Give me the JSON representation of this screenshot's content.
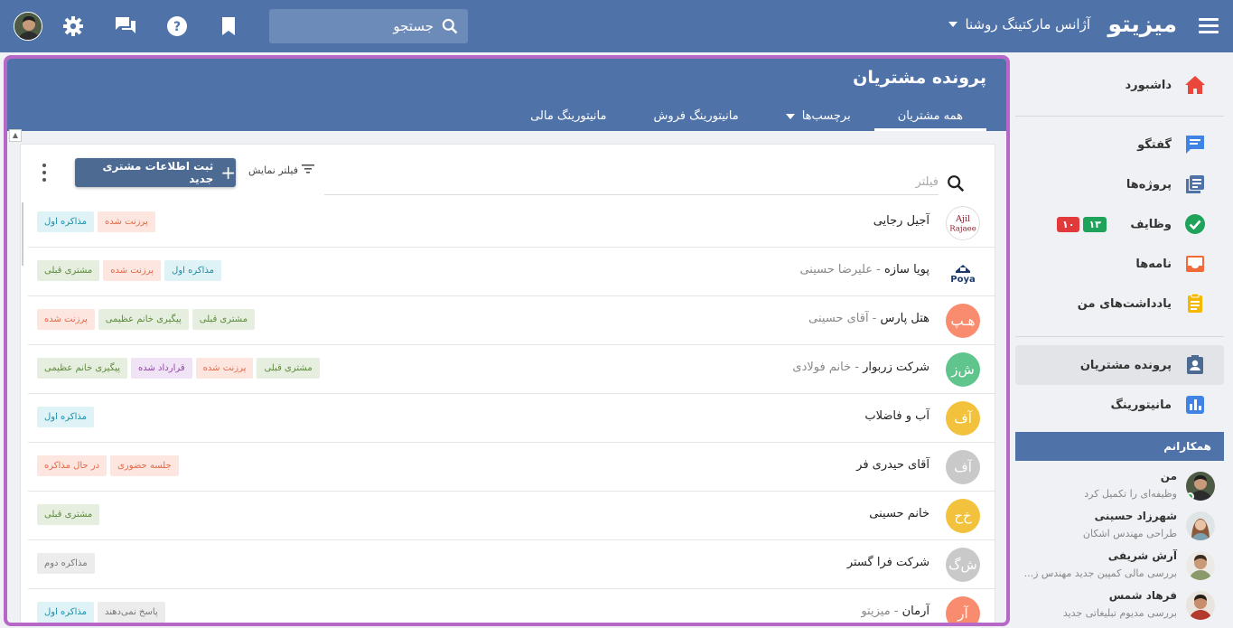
{
  "topbar": {
    "logo": "میزیتو",
    "agency": "آژانس مارکتینگ روشنا",
    "search_placeholder": "جستجو"
  },
  "sidebar": {
    "items": [
      {
        "label": "داشبورد",
        "icon": "home-icon"
      },
      {
        "label": "گفتگو",
        "icon": "chat-icon"
      },
      {
        "label": "پروژه‌ها",
        "icon": "projects-icon"
      },
      {
        "label": "وظایف",
        "icon": "check-circle-icon"
      },
      {
        "label": "نامه‌ها",
        "icon": "inbox-icon"
      },
      {
        "label": "یادداشت‌های من",
        "icon": "notes-icon"
      },
      {
        "label": "پرونده مشتریان",
        "icon": "contact-card-icon"
      },
      {
        "label": "مانیتورینگ",
        "icon": "bar-chart-icon"
      }
    ],
    "task_badges": {
      "green": "۱۳",
      "red": "۱۰"
    },
    "colleagues_title": "همکارانم",
    "colleagues": [
      {
        "name": "من",
        "status": "وظیفه‌ای را تکمیل کرد"
      },
      {
        "name": "شهرزاد حسینی",
        "status": "طراحی مهندس اشکان"
      },
      {
        "name": "آرش شریفی",
        "status": "بررسی مالی کمپین جدید مهندس ز..."
      },
      {
        "name": "فرهاد شمس",
        "status": "بررسی مدیوم تبلیغاتی جدید"
      }
    ]
  },
  "main": {
    "title": "پرونده مشتریان",
    "tabs": [
      "همه مشتریان",
      "برچسب‌ها",
      "مانیتورینگ فروش",
      "مانیتورینگ مالی"
    ],
    "filter_placeholder": "فیلتر",
    "filter_display_label": "فیلتر نمایش",
    "new_button_label": "ثبت اطلاعات مشتری جدید"
  },
  "customers": [
    {
      "name": "آجیل رجایی",
      "contact": "",
      "avatar": "Ajil Rajaee",
      "avatar_color": "#ffffff",
      "tags": [
        {
          "label": "مذاکره اول",
          "color": "blue"
        },
        {
          "label": "پرزنت شده",
          "color": "red"
        }
      ]
    },
    {
      "name": "پویا سازه",
      "contact": "علیرضا حسینی",
      "avatar": "Poya",
      "avatar_color": "#ffffff",
      "tags": [
        {
          "label": "مشتری قبلی",
          "color": "green"
        },
        {
          "label": "پرزنت شده",
          "color": "red"
        },
        {
          "label": "مذاکره اول",
          "color": "blue"
        }
      ]
    },
    {
      "name": "هتل پارس",
      "contact": "آقای حسینی",
      "avatar": "هـپ",
      "avatar_color": "#f98c6e",
      "tags": [
        {
          "label": "پرزنت شده",
          "color": "red"
        },
        {
          "label": "پیگیری خانم عظیمی",
          "color": "green"
        },
        {
          "label": "مشتری قبلی",
          "color": "green"
        }
      ]
    },
    {
      "name": "شرکت زربوار",
      "contact": "خانم فولادی",
      "avatar": "ش‌ز",
      "avatar_color": "#5fc58d",
      "tags": [
        {
          "label": "پیگیری خانم عظیمی",
          "color": "green"
        },
        {
          "label": "قرارداد شده",
          "color": "purple"
        },
        {
          "label": "پرزنت شده",
          "color": "red"
        },
        {
          "label": "مشتری قبلی",
          "color": "green"
        }
      ]
    },
    {
      "name": "آب و فاضلاب",
      "contact": "",
      "avatar": "آف",
      "avatar_color": "#f3c23c",
      "tags": [
        {
          "label": "مذاکره اول",
          "color": "blue"
        }
      ]
    },
    {
      "name": "آقای حیدری فر",
      "contact": "",
      "avatar": "آف",
      "avatar_color": "#c9c9c9",
      "tags": [
        {
          "label": "در حال مذاکره",
          "color": "red"
        },
        {
          "label": "جلسه حضوری",
          "color": "red"
        }
      ]
    },
    {
      "name": "خانم حسینی",
      "contact": "",
      "avatar": "خ‌ح",
      "avatar_color": "#f3c23c",
      "tags": [
        {
          "label": "مشتری قبلی",
          "color": "green"
        }
      ]
    },
    {
      "name": "شرکت فرا گستر",
      "contact": "",
      "avatar": "ش‌گ",
      "avatar_color": "#c9c9c9",
      "tags": [
        {
          "label": "مذاکره دوم",
          "color": "gray"
        }
      ]
    },
    {
      "name": "آرمان",
      "contact": "میزیتو",
      "avatar": "آر",
      "avatar_color": "#f98c6e",
      "tags": [
        {
          "label": "مذاکره اول",
          "color": "blue"
        },
        {
          "label": "پاسخ نمی‌دهند",
          "color": "gray"
        }
      ]
    }
  ],
  "colors": {
    "brand": "#4f73a9",
    "highlight_frame": "#b667c8"
  }
}
